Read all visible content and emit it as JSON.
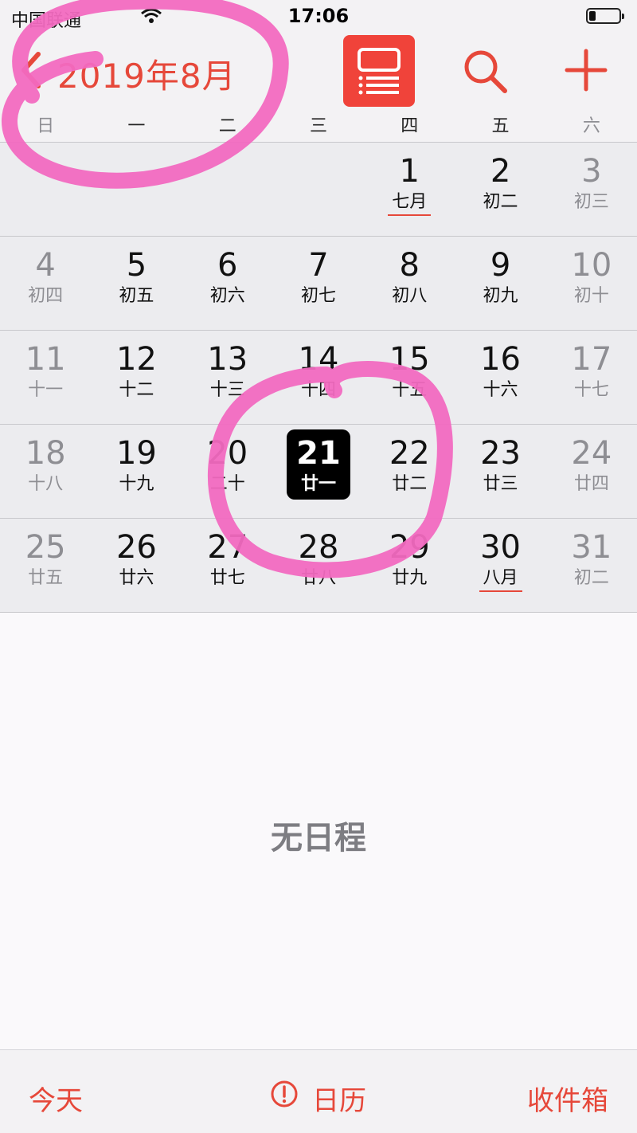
{
  "status_bar": {
    "carrier": "中国联通",
    "time": "17:06"
  },
  "header": {
    "back_icon": "chevron-left-icon",
    "title": "2019年8月",
    "list_view_icon": "list-view-icon",
    "search_icon": "search-icon",
    "add_icon": "plus-icon"
  },
  "weekdays": [
    "日",
    "一",
    "二",
    "三",
    "四",
    "五",
    "六"
  ],
  "weeks": [
    [
      null,
      null,
      null,
      null,
      {
        "day": "1",
        "lunar": "七月",
        "underline": true
      },
      {
        "day": "2",
        "lunar": "初二"
      },
      {
        "day": "3",
        "lunar": "初三",
        "weekend": true
      }
    ],
    [
      {
        "day": "4",
        "lunar": "初四",
        "weekend": true
      },
      {
        "day": "5",
        "lunar": "初五"
      },
      {
        "day": "6",
        "lunar": "初六"
      },
      {
        "day": "7",
        "lunar": "初七"
      },
      {
        "day": "8",
        "lunar": "初八"
      },
      {
        "day": "9",
        "lunar": "初九"
      },
      {
        "day": "10",
        "lunar": "初十",
        "weekend": true
      }
    ],
    [
      {
        "day": "11",
        "lunar": "十一",
        "weekend": true
      },
      {
        "day": "12",
        "lunar": "十二"
      },
      {
        "day": "13",
        "lunar": "十三"
      },
      {
        "day": "14",
        "lunar": "十四"
      },
      {
        "day": "15",
        "lunar": "十五"
      },
      {
        "day": "16",
        "lunar": "十六"
      },
      {
        "day": "17",
        "lunar": "十七",
        "weekend": true
      }
    ],
    [
      {
        "day": "18",
        "lunar": "十八",
        "weekend": true
      },
      {
        "day": "19",
        "lunar": "十九"
      },
      {
        "day": "20",
        "lunar": "二十"
      },
      {
        "day": "21",
        "lunar": "廿一",
        "selected": true
      },
      {
        "day": "22",
        "lunar": "廿二"
      },
      {
        "day": "23",
        "lunar": "廿三"
      },
      {
        "day": "24",
        "lunar": "廿四",
        "weekend": true
      }
    ],
    [
      {
        "day": "25",
        "lunar": "廿五",
        "weekend": true
      },
      {
        "day": "26",
        "lunar": "廿六"
      },
      {
        "day": "27",
        "lunar": "廿七"
      },
      {
        "day": "28",
        "lunar": "廿八"
      },
      {
        "day": "29",
        "lunar": "廿九"
      },
      {
        "day": "30",
        "lunar": "八月",
        "underline": true
      },
      {
        "day": "31",
        "lunar": "初二",
        "weekend": true
      }
    ]
  ],
  "events": {
    "empty_text": "无日程"
  },
  "toolbar": {
    "today": "今天",
    "calendars": "日历",
    "inbox": "收件箱"
  },
  "colors": {
    "accent": "#e6483a",
    "list_button": "#f0433a",
    "selected_day": "#000000",
    "annotation_pink": "#f26ac0"
  }
}
